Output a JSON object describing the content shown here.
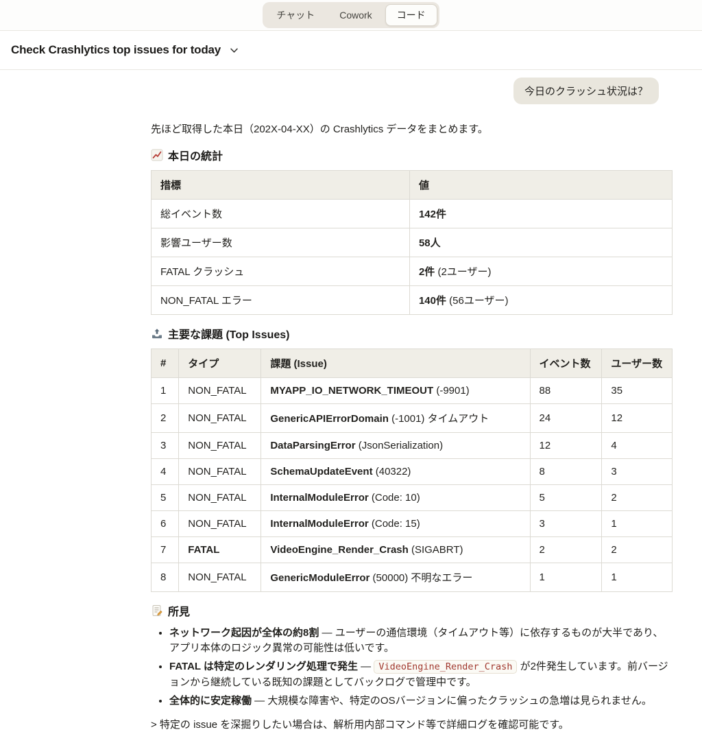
{
  "tabs": {
    "active_index": 2,
    "items": [
      {
        "label": "チャット"
      },
      {
        "label": "Cowork"
      },
      {
        "label": "コード"
      }
    ]
  },
  "header": {
    "title": "Check Crashlytics top issues for today",
    "chevron_icon": "chevron-down"
  },
  "conversation": {
    "user_message": "今日のクラッシュ状況は？",
    "intro": "先ほど取得した本日（202X-04-XX）の Crashlytics データをまとめます。"
  },
  "stats": {
    "icon": "chart-increasing",
    "title": "本日の統計",
    "headers": [
      "措標",
      "値"
    ],
    "rows": [
      {
        "label": "総イベント数",
        "value_bold": "142件",
        "value_rest": ""
      },
      {
        "label": "影響ユーザー数",
        "value_bold": "58人",
        "value_rest": ""
      },
      {
        "label": "FATAL クラッシュ",
        "value_bold": "2件",
        "value_rest": " (2ユーザー)"
      },
      {
        "label": "NON_FATAL エラー",
        "value_bold": "140件",
        "value_rest": " (56ユーザー)"
      }
    ]
  },
  "issues": {
    "icon": "outbox-tray",
    "title": "主要な課題 (Top Issues)",
    "headers": [
      "#",
      "タイプ",
      "課題 (Issue)",
      "イベント数",
      "ユーザー数"
    ],
    "rows": [
      {
        "num": "1",
        "type": "NON_FATAL",
        "issue_bold": "MYAPP_IO_NETWORK_TIMEOUT",
        "issue_rest": " (-9901)",
        "events": "88",
        "users": "35"
      },
      {
        "num": "2",
        "type": "NON_FATAL",
        "issue_bold": "GenericAPIErrorDomain",
        "issue_rest": " (-1001) タイムアウト",
        "events": "24",
        "users": "12"
      },
      {
        "num": "3",
        "type": "NON_FATAL",
        "issue_bold": "DataParsingError",
        "issue_rest": " (JsonSerialization)",
        "events": "12",
        "users": "4"
      },
      {
        "num": "4",
        "type": "NON_FATAL",
        "issue_bold": "SchemaUpdateEvent",
        "issue_rest": " (40322)",
        "events": "8",
        "users": "3"
      },
      {
        "num": "5",
        "type": "NON_FATAL",
        "issue_bold": "InternalModuleError",
        "issue_rest": " (Code: 10)",
        "events": "5",
        "users": "2"
      },
      {
        "num": "6",
        "type": "NON_FATAL",
        "issue_bold": "InternalModuleError",
        "issue_rest": " (Code: 15)",
        "events": "3",
        "users": "1"
      },
      {
        "num": "7",
        "type": "FATAL",
        "issue_bold": "VideoEngine_Render_Crash",
        "issue_rest": " (SIGABRT)",
        "events": "2",
        "users": "2"
      },
      {
        "num": "8",
        "type": "NON_FATAL",
        "issue_bold": "GenericModuleError",
        "issue_rest": " (50000) 不明なエラー",
        "events": "1",
        "users": "1"
      }
    ]
  },
  "findings": {
    "icon": "memo",
    "title": "所見",
    "bullets": [
      {
        "lead": "ネットワーク起因が全体の約8割",
        "rest": " — ユーザーの通信環境（タイムアウト等）に依存するものが大半であり、アプリ本体のロジック異常の可能性は低いです。"
      },
      {
        "lead": "FATAL は特定のレンダリング処理で発生",
        "sep": " — ",
        "code": "VideoEngine_Render_Crash",
        "rest": " が2件発生しています。前バージョンから継続している既知の課題としてバックログで管理中です。"
      },
      {
        "lead": "全体的に安定稼働",
        "rest": " — 大規模な障害や、特定のOSバージョンに偏ったクラッシュの急増は見られません。"
      }
    ],
    "note": "> 特定の issue を深掘りしたい場合は、解析用内部コマンド等で詳細ログを確認可能です。"
  },
  "colors": {
    "code_text": "#a1392f",
    "table_header_bg": "#f0eee7",
    "bubble_bg": "#e9e6dd",
    "tabbar_bg": "#ebe7e0"
  }
}
